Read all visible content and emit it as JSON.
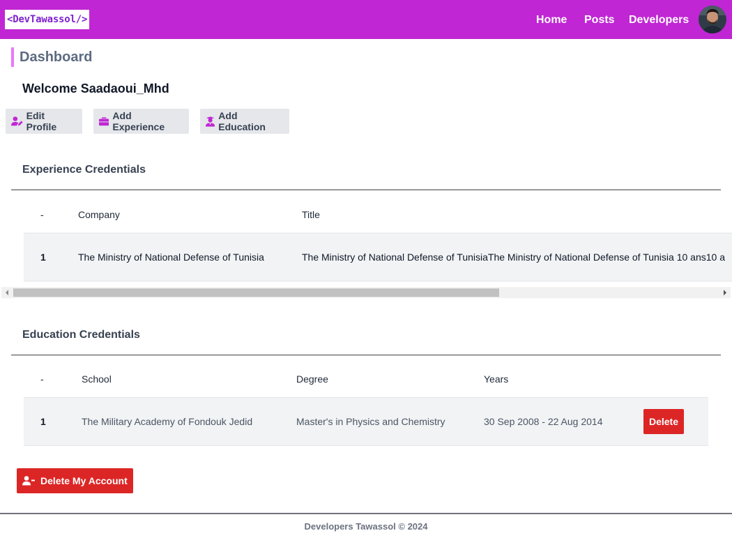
{
  "navbar": {
    "logo": "<DevTawassol/>",
    "links": [
      "Home",
      "Posts",
      "Developers"
    ],
    "avatar_icon": "user-avatar"
  },
  "dashboard": {
    "title": "Dashboard",
    "welcome": "Welcome Saadaoui_Mhd"
  },
  "actions": {
    "edit_profile": "Edit Profile",
    "add_experience": "Add Experience",
    "add_education": "Add Education",
    "icon_color": "#c026d3"
  },
  "experience": {
    "title": "Experience Credentials",
    "headers": {
      "index": "-",
      "company": "Company",
      "title": "Title"
    },
    "rows": [
      {
        "index": "1",
        "company": "The Ministry of National Defense of Tunisia",
        "title": "The Ministry of National Defense of TunisiaThe Ministry of National Defense of Tunisia 10 ans10 a"
      }
    ]
  },
  "education": {
    "title": "Education Credentials",
    "headers": {
      "index": "-",
      "school": "School",
      "degree": "Degree",
      "years": "Years"
    },
    "rows": [
      {
        "index": "1",
        "school": "The Military Academy of Fondouk Jedid",
        "degree": "Master's in Physics and Chemistry",
        "years": "30 Sep 2008 - 22 Aug 2014",
        "delete": "Delete"
      }
    ]
  },
  "delete_account": "Delete My Account",
  "footer": "Developers Tawassol © 2024",
  "colors": {
    "brand": "#c026d3",
    "danger": "#dc2626",
    "accent_bar": "#e879f9"
  }
}
